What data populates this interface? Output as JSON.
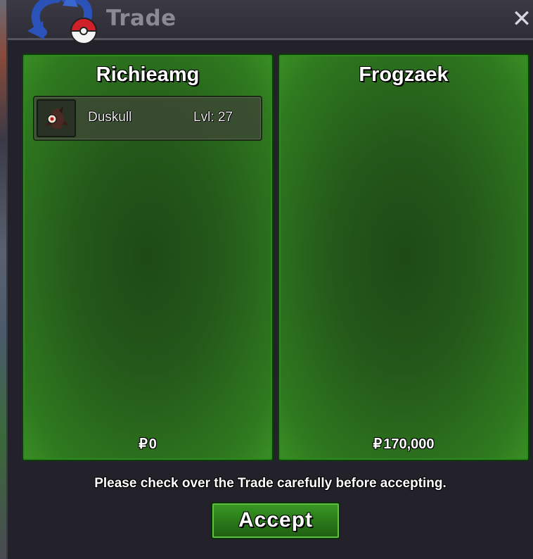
{
  "window": {
    "title": "Trade",
    "close_glyph": "✕"
  },
  "left_panel": {
    "player": "Richieamg",
    "pokemon": [
      {
        "name": "Duskull",
        "level": "Lvl: 27",
        "icon": "duskull-icon"
      }
    ],
    "currency_symbol": "₽",
    "money": "0"
  },
  "right_panel": {
    "player": "Frogzaek",
    "pokemon": [],
    "currency_symbol": "₽",
    "money": "170,000"
  },
  "notice": "Please check over the Trade carefully before accepting.",
  "accept_label": "Accept",
  "colors": {
    "panel_green": "#2f7a1f",
    "button_green": "#2a7a1a",
    "window_bg": "#23222b",
    "title_text": "#8b8a94"
  }
}
